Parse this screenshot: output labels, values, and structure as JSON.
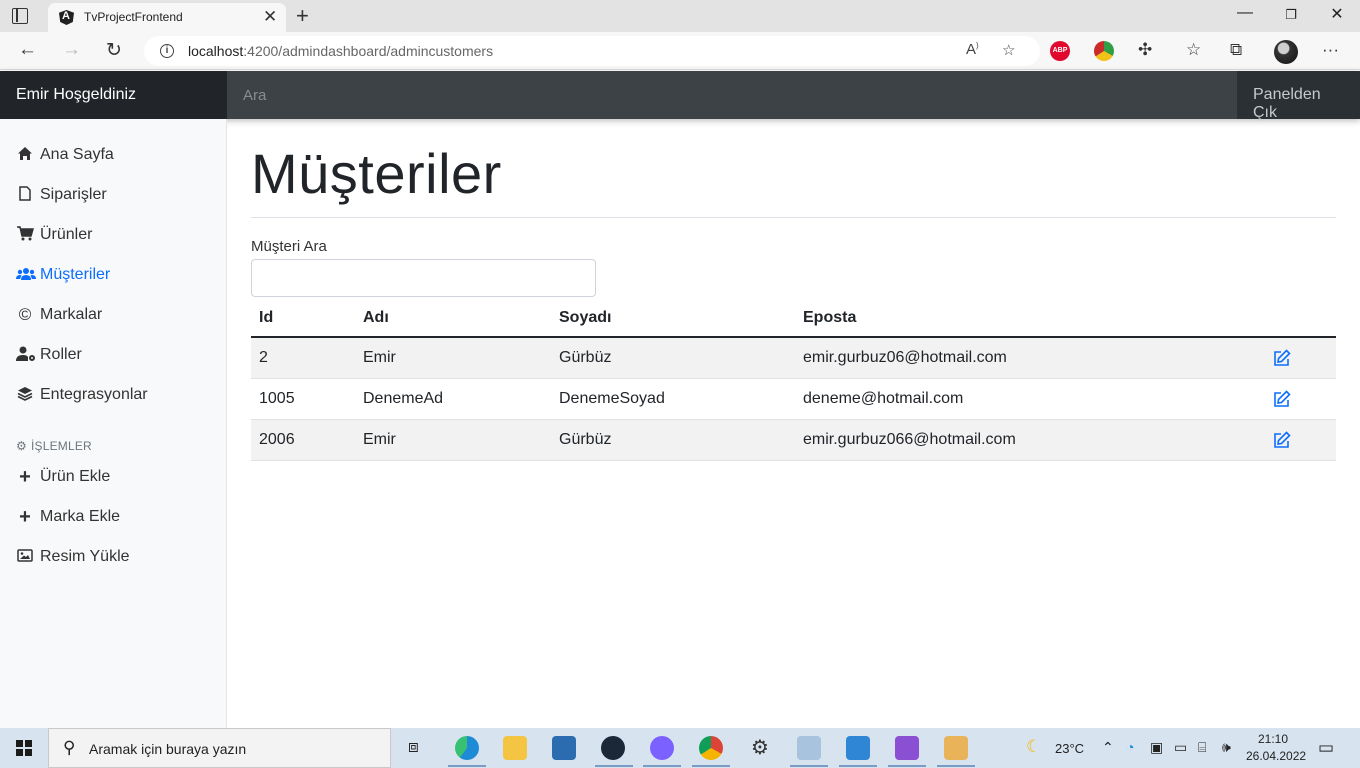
{
  "browser": {
    "tab_title": "TvProjectFrontend",
    "url_host": "localhost",
    "url_path": ":4200/admindashboard/admincustomers",
    "ext_abp_label": "ABP"
  },
  "navbar": {
    "brand": "Emir Hoşgeldiniz",
    "search_placeholder": "Ara",
    "signout": "Panelden Çık"
  },
  "sidebar": {
    "items": [
      {
        "label": "Ana Sayfa",
        "icon": "home-icon"
      },
      {
        "label": "Siparişler",
        "icon": "file-icon"
      },
      {
        "label": "Ürünler",
        "icon": "cart-icon"
      },
      {
        "label": "Müşteriler",
        "icon": "users-icon",
        "active": true
      },
      {
        "label": "Markalar",
        "icon": "copyright-icon"
      },
      {
        "label": "Roller",
        "icon": "user-gear-icon"
      },
      {
        "label": "Entegrasyonlar",
        "icon": "layers-icon"
      }
    ],
    "section_title": "İŞLEMLER",
    "actions": [
      {
        "label": "Ürün Ekle",
        "icon": "plus-icon"
      },
      {
        "label": "Marka Ekle",
        "icon": "plus-icon"
      },
      {
        "label": "Resim Yükle",
        "icon": "image-icon"
      }
    ]
  },
  "main": {
    "title": "Müşteriler",
    "search_label": "Müşteri Ara",
    "table": {
      "headers": [
        "Id",
        "Adı",
        "Soyadı",
        "Eposta"
      ],
      "rows": [
        [
          "2",
          "Emir",
          "Gürbüz",
          "emir.gurbuz06@hotmail.com"
        ],
        [
          "1005",
          "DenemeAd",
          "DenemeSoyad",
          "deneme@hotmail.com"
        ],
        [
          "2006",
          "Emir",
          "Gürbüz",
          "emir.gurbuz066@hotmail.com"
        ]
      ]
    }
  },
  "taskbar": {
    "search_text": "Aramak için buraya yazın",
    "weather": "23°C",
    "time": "21:10",
    "date": "26.04.2022"
  },
  "colors": {
    "accent": "#0d6efd",
    "navbar": "#343a40",
    "brand_bg": "#212529"
  }
}
